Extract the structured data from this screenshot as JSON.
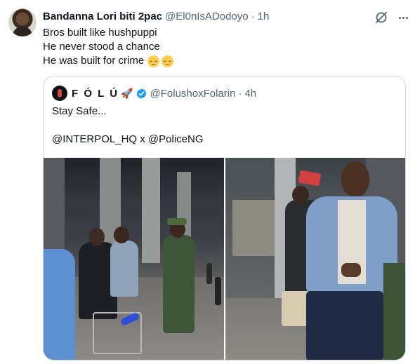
{
  "tweet": {
    "author_name": "Bandanna Lori biti 2pac",
    "author_handle": "@El0nIsADodoyo",
    "separator": "·",
    "time": "1h",
    "lines": [
      "Bros built like hushpuppi",
      "He never stood a chance",
      "He was built for crime"
    ],
    "line3_emojis": [
      "relieved-face",
      "relieved-face"
    ]
  },
  "quoted": {
    "author_name": "F Ó L Ú",
    "author_emoji": "rocket",
    "verified": true,
    "author_handle": "@FolushoxFolarin",
    "separator": "·",
    "time": "4h",
    "line1": "Stay Safe...",
    "line2": "@INTERPOL_HQ x @PoliceNG",
    "photos": [
      {
        "label": "Arrest scene at airport with soldier"
      },
      {
        "label": "Man in denim jacket being escorted"
      }
    ]
  },
  "colors": {
    "text": "#0f1419",
    "muted": "#536471",
    "border": "#cfd9de",
    "verified": "#1d9bf0"
  }
}
